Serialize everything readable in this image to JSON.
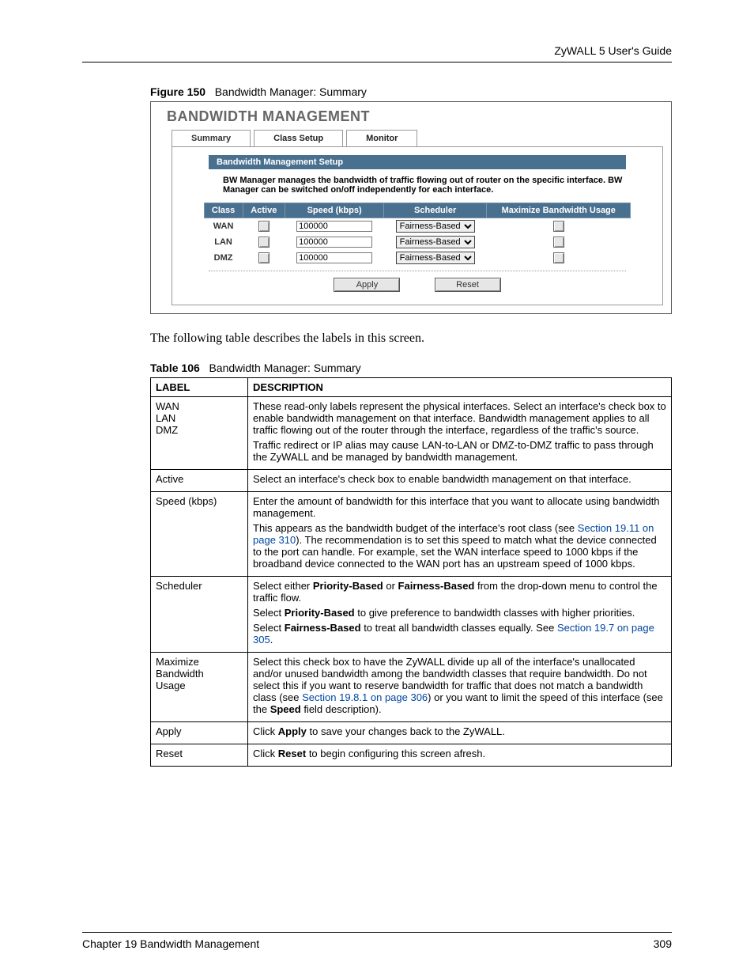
{
  "header": {
    "running": "ZyWALL 5 User's Guide"
  },
  "figure": {
    "label": "Figure 150",
    "title": "Bandwidth Manager: Summary"
  },
  "shot": {
    "title": "BANDWIDTH MANAGEMENT",
    "tabs": {
      "summary": "Summary",
      "class_setup": "Class Setup",
      "monitor": "Monitor"
    },
    "section_hdr": "Bandwidth Management Setup",
    "description": "BW Manager manages the bandwidth of traffic flowing out of router on the specific interface. BW Manager can be switched on/off independently for each interface.",
    "cols": {
      "class": "Class",
      "active": "Active",
      "speed": "Speed (kbps)",
      "scheduler": "Scheduler",
      "max": "Maximize Bandwidth Usage"
    },
    "rows": [
      {
        "class": "WAN",
        "speed": "100000",
        "scheduler": "Fairness-Based"
      },
      {
        "class": "LAN",
        "speed": "100000",
        "scheduler": "Fairness-Based"
      },
      {
        "class": "DMZ",
        "speed": "100000",
        "scheduler": "Fairness-Based"
      }
    ],
    "buttons": {
      "apply": "Apply",
      "reset": "Reset"
    }
  },
  "para1": "The following table describes the labels in this screen.",
  "tableCaption": {
    "label": "Table 106",
    "title": "Bandwidth Manager: Summary"
  },
  "descTable": {
    "head": {
      "label": "LABEL",
      "description": "DESCRIPTION"
    },
    "rows": [
      {
        "label_lines": [
          "WAN",
          "LAN",
          "DMZ"
        ],
        "desc": [
          {
            "segments": [
              {
                "t": "These read-only labels represent the physical interfaces. Select an interface's check box to enable bandwidth management on that interface. Bandwidth management applies to all traffic flowing out of the router through the interface, regardless of the traffic's source."
              }
            ]
          },
          {
            "segments": [
              {
                "t": "Traffic redirect or IP alias may cause LAN-to-LAN or DMZ-to-DMZ traffic to pass through the ZyWALL and be managed by bandwidth management."
              }
            ]
          }
        ]
      },
      {
        "label_lines": [
          "Active"
        ],
        "desc": [
          {
            "segments": [
              {
                "t": "Select an interface's check box to enable bandwidth management on that interface."
              }
            ]
          }
        ]
      },
      {
        "label_lines": [
          "Speed (kbps)"
        ],
        "desc": [
          {
            "segments": [
              {
                "t": "Enter the amount of bandwidth for this interface that you want to allocate using bandwidth management."
              }
            ]
          },
          {
            "segments": [
              {
                "t": "This appears as the bandwidth budget of the interface's root class (see "
              },
              {
                "t": "Section 19.11 on page 310",
                "link": true
              },
              {
                "t": "). The recommendation is to set this speed to match what the device connected to the port can handle. For example, set the WAN interface speed to 1000 kbps if the broadband device connected to the WAN port has an upstream speed of 1000 kbps."
              }
            ]
          }
        ]
      },
      {
        "label_lines": [
          "Scheduler"
        ],
        "desc": [
          {
            "segments": [
              {
                "t": "Select either "
              },
              {
                "t": "Priority-Based",
                "bold": true
              },
              {
                "t": " or "
              },
              {
                "t": "Fairness-Based",
                "bold": true
              },
              {
                "t": " from the drop-down menu to control the traffic flow."
              }
            ]
          },
          {
            "segments": [
              {
                "t": "Select "
              },
              {
                "t": "Priority-Based",
                "bold": true
              },
              {
                "t": " to give preference to bandwidth classes with higher priorities."
              }
            ]
          },
          {
            "segments": [
              {
                "t": "Select "
              },
              {
                "t": "Fairness-Based",
                "bold": true
              },
              {
                "t": " to treat all bandwidth classes equally. See "
              },
              {
                "t": "Section 19.7 on page 305",
                "link": true
              },
              {
                "t": "."
              }
            ]
          }
        ]
      },
      {
        "label_lines": [
          "Maximize",
          "Bandwidth",
          "Usage"
        ],
        "desc": [
          {
            "segments": [
              {
                "t": "Select this check box to have the ZyWALL divide up all of the interface's unallocated and/or unused bandwidth among the bandwidth classes that require bandwidth. Do not select this if you want to reserve bandwidth for traffic that does not match a bandwidth class (see "
              },
              {
                "t": "Section 19.8.1 on page 306",
                "link": true
              },
              {
                "t": ") or you want to limit the speed of this interface (see the "
              },
              {
                "t": "Speed",
                "bold": true
              },
              {
                "t": " field description)."
              }
            ]
          }
        ]
      },
      {
        "label_lines": [
          "Apply"
        ],
        "desc": [
          {
            "segments": [
              {
                "t": "Click "
              },
              {
                "t": "Apply",
                "bold": true
              },
              {
                "t": " to save your changes back to the ZyWALL."
              }
            ]
          }
        ]
      },
      {
        "label_lines": [
          "Reset"
        ],
        "desc": [
          {
            "segments": [
              {
                "t": "Click "
              },
              {
                "t": "Reset",
                "bold": true
              },
              {
                "t": " to begin configuring this screen afresh."
              }
            ]
          }
        ]
      }
    ]
  },
  "footer": {
    "left": "Chapter 19 Bandwidth Management",
    "right": "309"
  }
}
